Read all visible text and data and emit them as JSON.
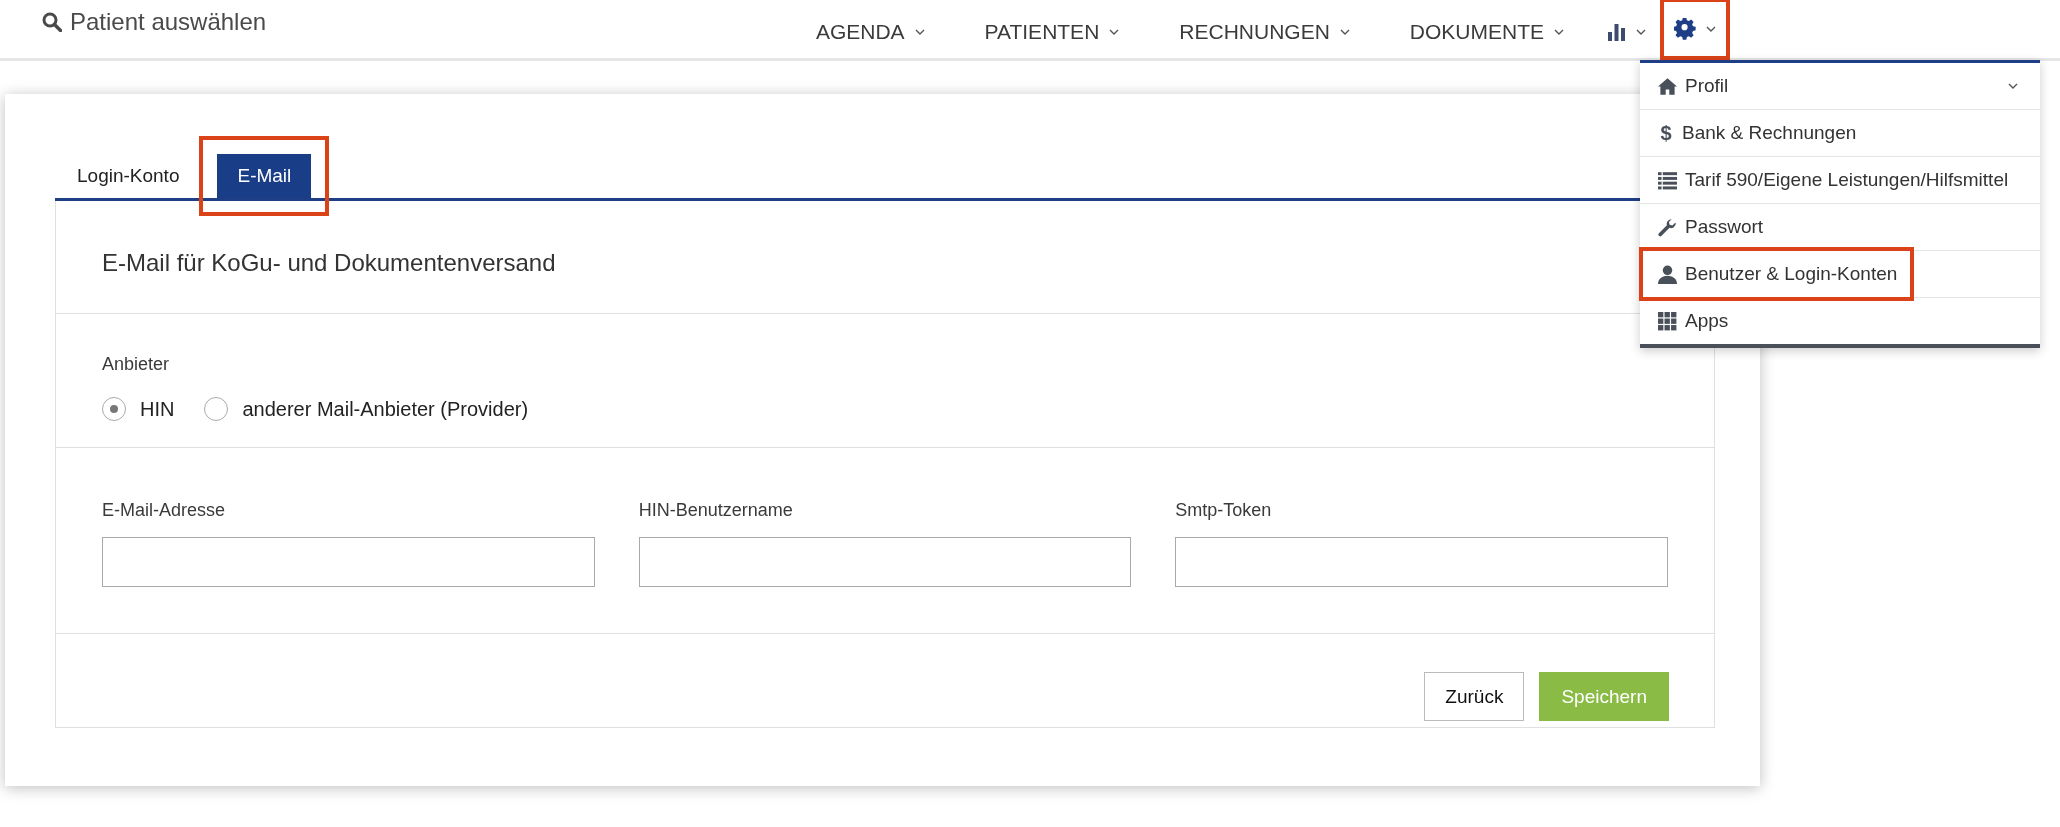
{
  "patient_search": {
    "label": "Patient auswählen"
  },
  "nav": [
    {
      "kind": "text",
      "label": "AGENDA",
      "highlighted": false
    },
    {
      "kind": "text",
      "label": "PATIENTEN",
      "highlighted": false
    },
    {
      "kind": "text",
      "label": "RECHNUNGEN",
      "highlighted": false
    },
    {
      "kind": "text",
      "label": "DOKUMENTE",
      "highlighted": false
    },
    {
      "kind": "chart",
      "highlighted": false
    },
    {
      "kind": "settings",
      "highlighted": true
    }
  ],
  "settings_menu": [
    {
      "kind": "home",
      "label": "Profil",
      "submenu": true,
      "highlighted": false
    },
    {
      "kind": "dollar",
      "icon_char": "$",
      "label": "Bank & Rechnungen",
      "submenu": false,
      "highlighted": false
    },
    {
      "kind": "list",
      "label": "Tarif 590/Eigene Leistungen/Hilfsmittel",
      "submenu": false,
      "highlighted": false
    },
    {
      "kind": "wrench",
      "label": "Passwort",
      "submenu": false,
      "highlighted": false
    },
    {
      "kind": "user",
      "label": "Benutzer & Login-Konten",
      "submenu": false,
      "highlighted": true
    },
    {
      "kind": "grid",
      "label": "Apps",
      "submenu": false,
      "highlighted": false
    }
  ],
  "tabs": [
    {
      "label": "Login-Konto",
      "selected": false,
      "highlighted": false
    },
    {
      "label": "E-Mail",
      "selected": true,
      "highlighted": true
    }
  ],
  "section_title": "E-Mail für KoGu- und Dokumentenversand",
  "provider": {
    "label": "Anbieter",
    "options": [
      {
        "label": "HIN",
        "selected": true
      },
      {
        "label": "anderer Mail-Anbieter (Provider)",
        "selected": false
      }
    ]
  },
  "fields": [
    {
      "label": "E-Mail-Adresse"
    },
    {
      "label": "HIN-Benutzername"
    },
    {
      "label": "Smtp-Token"
    }
  ],
  "buttons": [
    {
      "label": "Zurück",
      "kind": "secondary"
    },
    {
      "label": "Speichern",
      "kind": "primary"
    }
  ]
}
